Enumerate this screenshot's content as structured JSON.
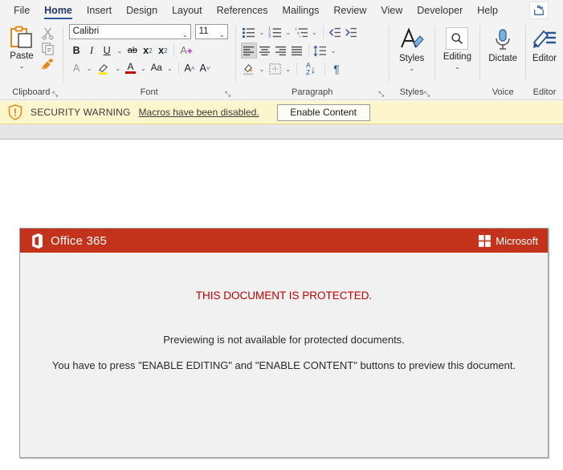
{
  "window": {
    "tabs": [
      {
        "label": "File",
        "active": false
      },
      {
        "label": "Home",
        "active": true
      },
      {
        "label": "Insert",
        "active": false
      },
      {
        "label": "Design",
        "active": false
      },
      {
        "label": "Layout",
        "active": false
      },
      {
        "label": "References",
        "active": false
      },
      {
        "label": "Mailings",
        "active": false
      },
      {
        "label": "Review",
        "active": false
      },
      {
        "label": "View",
        "active": false
      },
      {
        "label": "Developer",
        "active": false
      },
      {
        "label": "Help",
        "active": false
      }
    ],
    "share_icon": "share-icon"
  },
  "ribbon": {
    "clipboard": {
      "group_label": "Clipboard",
      "paste_label": "Paste",
      "paste_caret": "⌄",
      "dialog_launcher": "⤡",
      "icons": [
        "paste-clipboard-icon",
        "cut-scissors-icon",
        "copy-icon",
        "format-painter-icon"
      ]
    },
    "font": {
      "group_label": "Font",
      "font_name_value": "Calibri",
      "font_size_value": "11",
      "dialog_launcher": "⤡",
      "bold_label": "B",
      "italic_label": "I",
      "underline_label": "U",
      "strikethrough_label": "ab",
      "subscript_label": "x",
      "subscript_sub": "2",
      "superscript_label": "x",
      "superscript_sup": "2",
      "clear_formatting_label": "A",
      "text_effects_label": "A",
      "highlight_label": "✎",
      "font_color_label": "A",
      "change_case_label": "Aa",
      "grow_font_label": "A",
      "grow_font_mark": "˄",
      "shrink_font_label": "A",
      "shrink_font_mark": "˅",
      "caret": "⌄"
    },
    "paragraph": {
      "group_label": "Paragraph",
      "dialog_launcher": "⤡",
      "bullets": "bullet-list-icon",
      "numbering": "numbered-list-icon",
      "multilevel": "multilevel-list-icon",
      "decrease_indent": "decrease-indent-icon",
      "increase_indent": "increase-indent-icon",
      "align_left": "align-left-icon",
      "align_center": "align-center-icon",
      "align_right": "align-right-icon",
      "justify": "justify-icon",
      "line_spacing": "line-spacing-icon",
      "shading": "shading-icon",
      "borders": "borders-icon",
      "sort_label_a": "A",
      "sort_label_z": "Z",
      "sort_arrow": "↓",
      "show_marks": "¶",
      "caret": "⌄"
    },
    "styles": {
      "group_label": "Styles",
      "button_label": "Styles",
      "caret": "⌄",
      "dialog_launcher": "⤡"
    },
    "editing": {
      "group_label": "",
      "button_label": "Editing",
      "caret": "⌄",
      "icon": "search-icon"
    },
    "voice": {
      "group_label": "Voice",
      "button_label": "Dictate",
      "icon": "microphone-icon"
    },
    "editor": {
      "group_label": "Editor",
      "button_label": "Editor",
      "icon": "editor-pen-icon"
    }
  },
  "security_bar": {
    "icon": "shield-warning-icon",
    "title": "SECURITY WARNING",
    "message": "Macros have been disabled.",
    "button_label": "Enable Content",
    "background_color": "#fdf6cd"
  },
  "document": {
    "header": {
      "brand_icon": "office-365-logo-icon",
      "brand_text": "Office 365",
      "microsoft_icon": "microsoft-logo-icon",
      "microsoft_text": "Microsoft",
      "background_color": "#c3321b"
    },
    "lines": {
      "protected": "THIS DOCUMENT IS PROTECTED.",
      "protected_color": "#c00000",
      "preview": "Previewing is not available for protected documents.",
      "enable": "You have to press \"ENABLE EDITING\" and \"ENABLE CONTENT\" buttons to preview this document."
    }
  }
}
